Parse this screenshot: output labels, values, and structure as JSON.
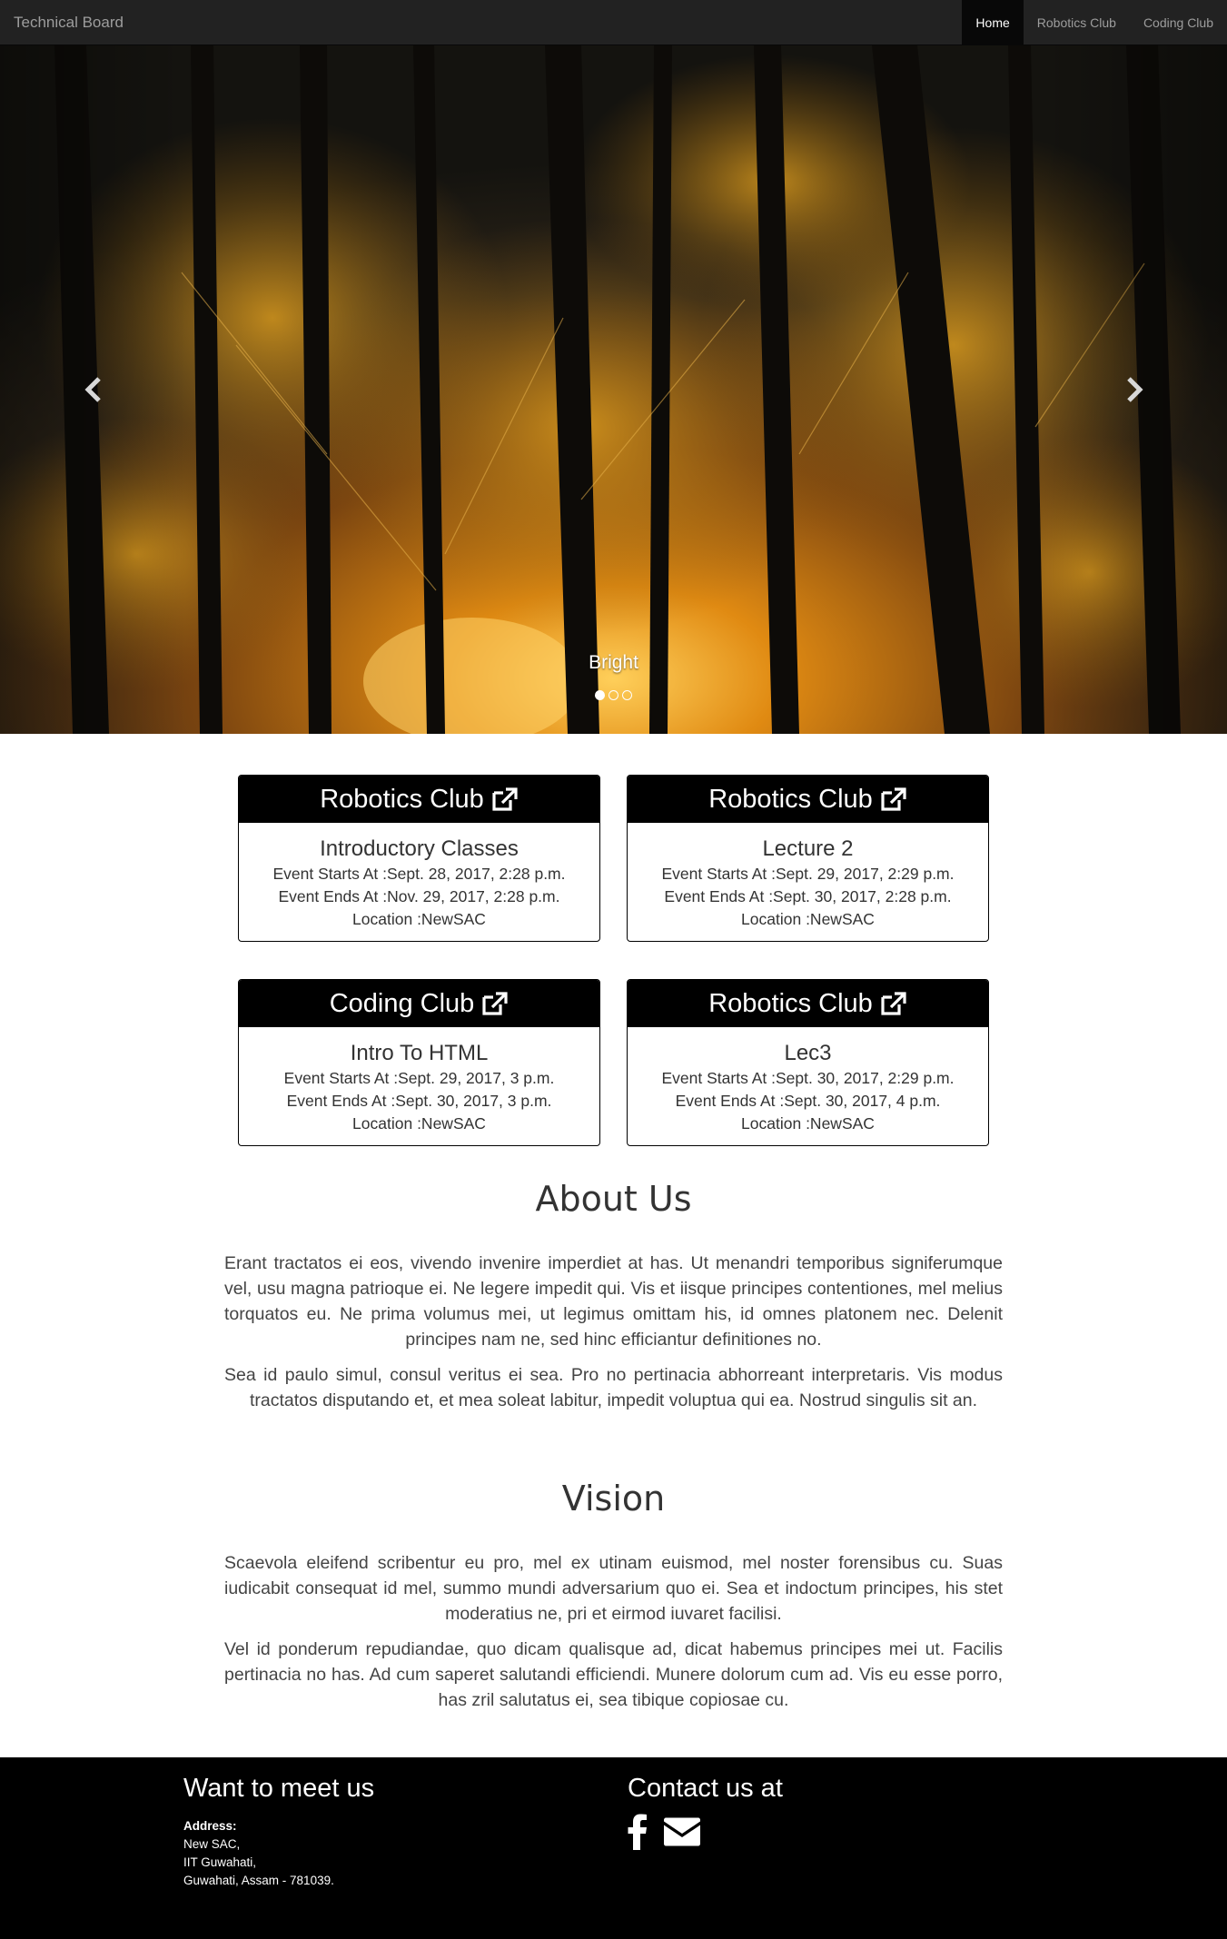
{
  "navbar": {
    "brand": "Technical Board",
    "items": [
      {
        "label": "Home",
        "active": true
      },
      {
        "label": "Robotics Club",
        "active": false
      },
      {
        "label": "Coding Club",
        "active": false
      }
    ]
  },
  "carousel": {
    "caption": "Bright",
    "slide_count": 3,
    "active_index": 0,
    "prev_icon": "chevron-left-icon",
    "next_icon": "chevron-right-icon"
  },
  "events": [
    {
      "club": "Robotics Club",
      "title": "Introductory Classes",
      "starts": "Event Starts At :Sept. 28, 2017, 2:28 p.m.",
      "ends": "Event Ends At :Nov. 29, 2017, 2:28 p.m.",
      "location": "Location :NewSAC"
    },
    {
      "club": "Robotics Club",
      "title": "Lecture 2",
      "starts": "Event Starts At :Sept. 29, 2017, 2:29 p.m.",
      "ends": "Event Ends At :Sept. 30, 2017, 2:28 p.m.",
      "location": "Location :NewSAC"
    },
    {
      "club": "Coding Club",
      "title": "Intro To HTML",
      "starts": "Event Starts At :Sept. 29, 2017, 3 p.m.",
      "ends": "Event Ends At :Sept. 30, 2017, 3 p.m.",
      "location": "Location :NewSAC"
    },
    {
      "club": "Robotics Club",
      "title": "Lec3",
      "starts": "Event Starts At :Sept. 30, 2017, 2:29 p.m.",
      "ends": "Event Ends At :Sept. 30, 2017, 4 p.m.",
      "location": "Location :NewSAC"
    }
  ],
  "about": {
    "title": "About Us",
    "paragraphs": [
      "Erant tractatos ei eos, vivendo invenire imperdiet at has. Ut menandri temporibus signiferumque vel, usu magna patrioque ei. Ne legere impedit qui. Vis et iisque principes contentiones, mel melius torquatos eu. Ne prima volumus mei, ut legimus omittam his, id omnes platonem nec. Delenit principes nam ne, sed hinc efficiantur definitiones no.",
      "Sea id paulo simul, consul veritus ei sea. Pro no pertinacia abhorreant interpretaris. Vis modus tractatos disputando et, et mea soleat labitur, impedit voluptua qui ea. Nostrud singulis sit an."
    ]
  },
  "vision": {
    "title": "Vision",
    "paragraphs": [
      "Scaevola eleifend scribentur eu pro, mel ex utinam euismod, mel noster forensibus cu. Suas iudicabit consequat id mel, summo mundi adversarium quo ei. Sea et indoctum principes, his stet moderatius ne, pri et eirmod iuvaret facilisi.",
      "Vel id ponderum repudiandae, quo dicam qualisque ad, dicat habemus principes mei ut. Facilis pertinacia no has. Ad cum saperet salutandi efficiendi. Munere dolorum cum ad. Vis eu esse porro, has zril salutatus ei, sea tibique copiosae cu."
    ]
  },
  "footer": {
    "meet_title": "Want to meet us",
    "address_label": "Address:",
    "address_lines": [
      "New SAC,",
      "IIT Guwahati,",
      "Guwahati, Assam - 781039."
    ],
    "contact_title": "Contact us at",
    "contact_icons": [
      "facebook-icon",
      "envelope-icon"
    ]
  },
  "colors": {
    "navbar_bg": "#222222",
    "nav_active_bg": "#080808",
    "card_header_bg": "#000000",
    "footer_bg": "#000000"
  }
}
